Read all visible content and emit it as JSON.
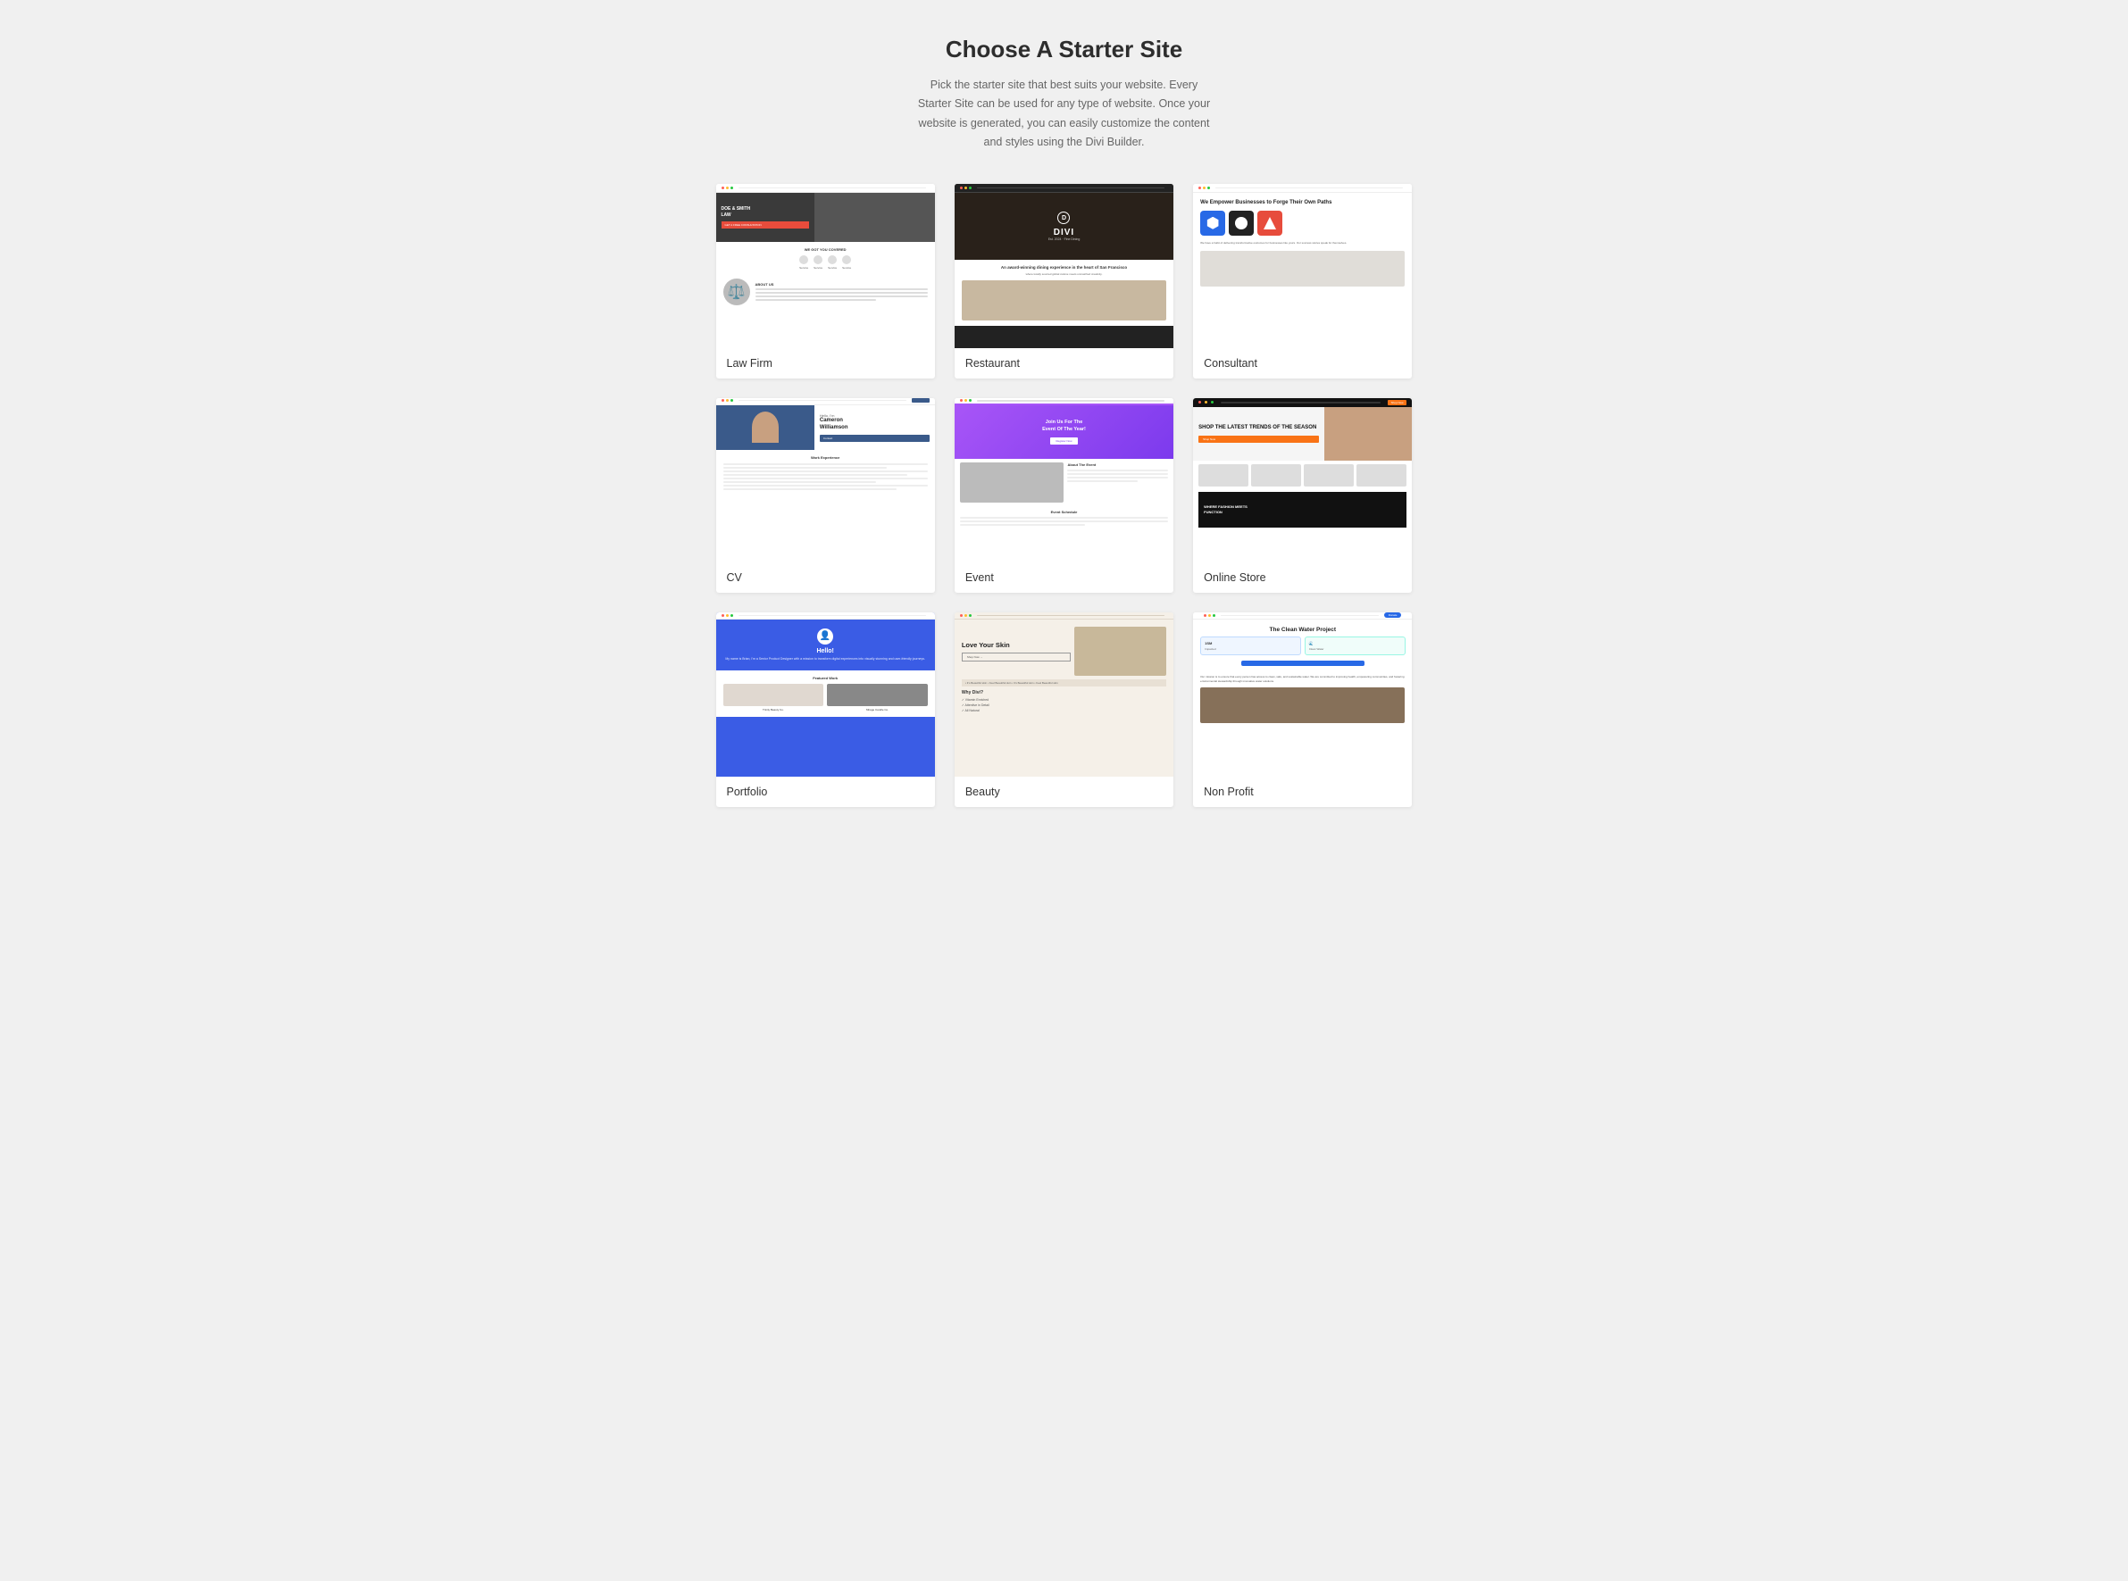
{
  "header": {
    "title": "Choose A Starter Site",
    "subtitle": "Pick the starter site that best suits your website. Every Starter Site can be used for any type of website. Once your website is generated, you can easily customize the content and styles using the Divi Builder."
  },
  "cards": [
    {
      "id": "law-firm",
      "label": "Law Firm",
      "type": "law"
    },
    {
      "id": "restaurant",
      "label": "Restaurant",
      "type": "restaurant"
    },
    {
      "id": "consultant",
      "label": "Consultant",
      "type": "consultant"
    },
    {
      "id": "cv",
      "label": "CV",
      "type": "cv"
    },
    {
      "id": "event",
      "label": "Event",
      "type": "event"
    },
    {
      "id": "online-store",
      "label": "Online Store",
      "type": "store"
    },
    {
      "id": "portfolio",
      "label": "Portfolio",
      "type": "portfolio"
    },
    {
      "id": "beauty",
      "label": "Beauty",
      "type": "beauty"
    },
    {
      "id": "non-profit",
      "label": "Non Profit",
      "type": "nonprofit"
    }
  ]
}
